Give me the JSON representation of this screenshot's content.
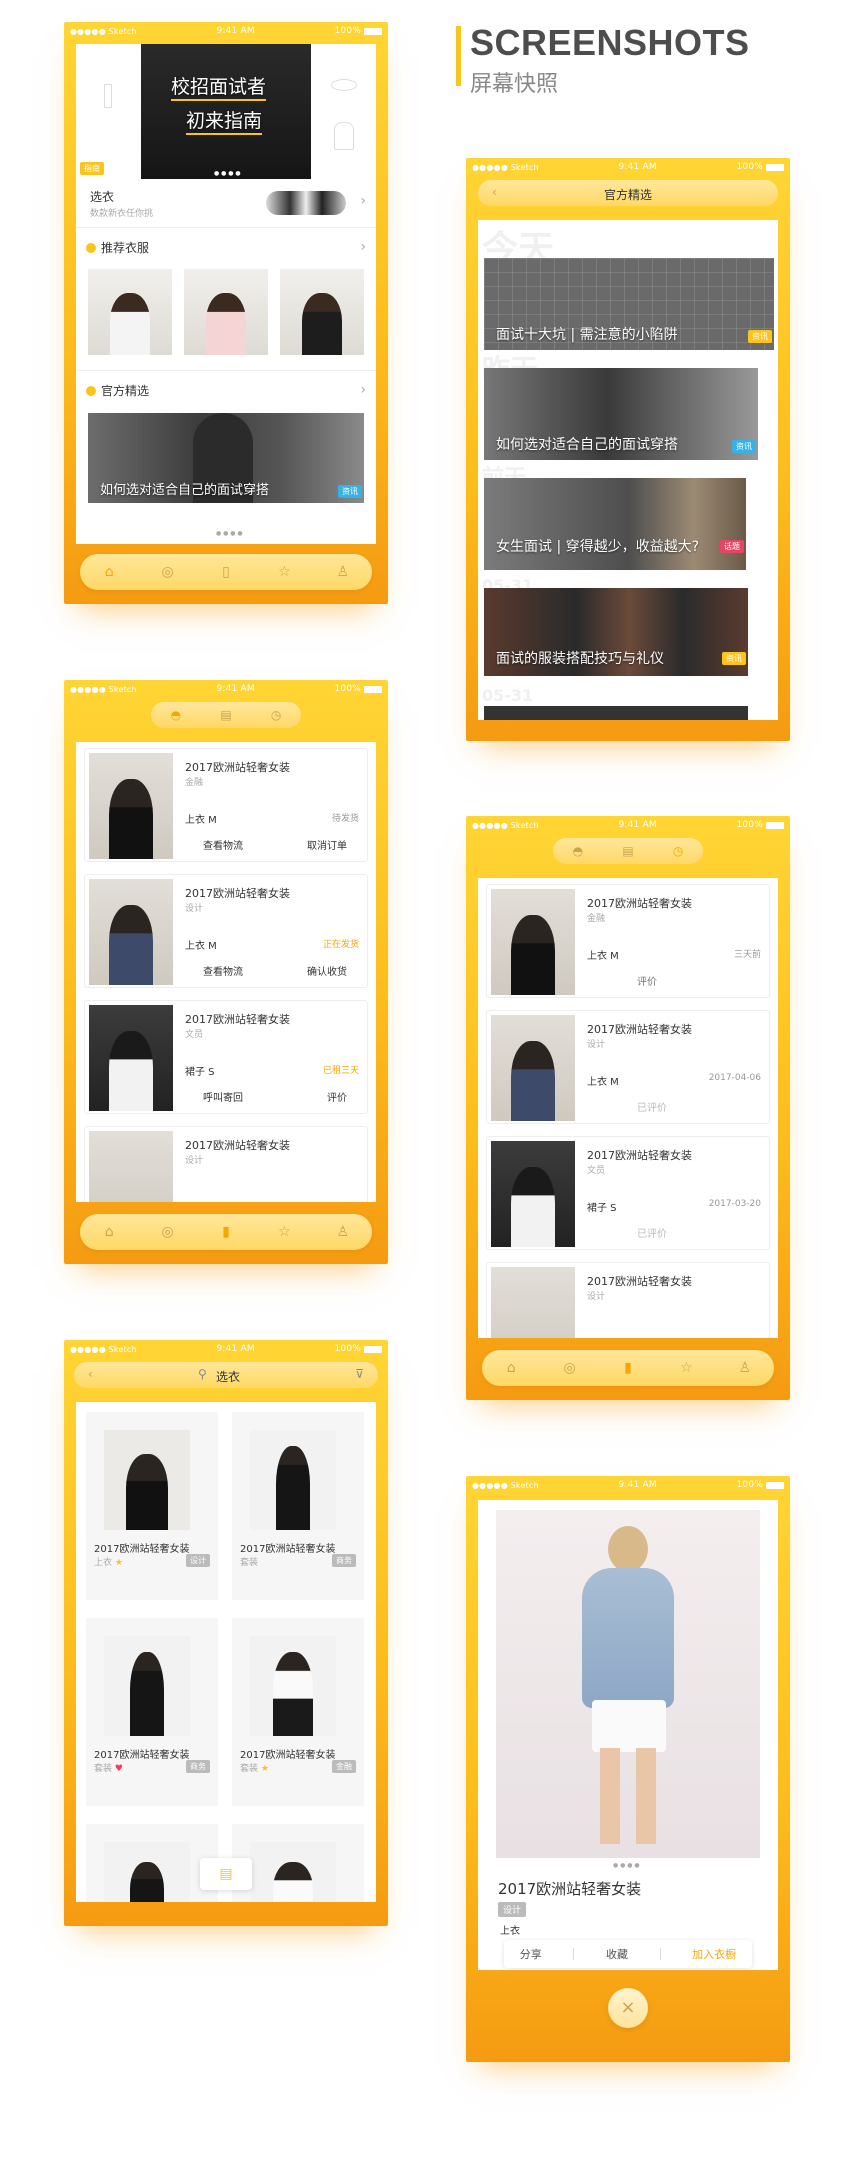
{
  "header": {
    "title_en": "SCREENSHOTS",
    "title_cn": "屏幕快照"
  },
  "status": {
    "carrier": "●●●●● Sketch",
    "time": "9:41 AM",
    "battery": "100%"
  },
  "home": {
    "banner_line1": "校招面试者",
    "banner_line2": "初来指南",
    "banner_tag": "指南",
    "pick_title": "选衣",
    "pick_sub": "数款新衣任你挑",
    "recommend_title": "推荐衣服",
    "official_title": "官方精选",
    "official_caption": "如何选对适合自己的面试穿搭",
    "official_tag": "资讯"
  },
  "official": {
    "nav_title": "官方精选",
    "ghost": [
      "今天",
      "昨天",
      "前天",
      "05-31",
      "05-31"
    ],
    "articles": [
      {
        "title": "面试十大坑 | 需注意的小陷阱",
        "tag": "资讯"
      },
      {
        "title": "如何选对适合自己的面试穿搭",
        "tag": "资讯"
      },
      {
        "title": "女生面试 | 穿得越少，收益越大?",
        "tag": "话题"
      },
      {
        "title": "面试的服装搭配技巧与礼仪",
        "tag": "资讯"
      }
    ]
  },
  "orders": [
    {
      "name": "2017欧洲站轻奢女装",
      "sub": "金融",
      "size": "上衣    M",
      "status": "待发货",
      "a1": "查看物流",
      "a2": "取消订单"
    },
    {
      "name": "2017欧洲站轻奢女装",
      "sub": "设计",
      "size": "上衣    M",
      "status": "正在发货",
      "a1": "查看物流",
      "a2": "确认收货"
    },
    {
      "name": "2017欧洲站轻奢女装",
      "sub": "文员",
      "size": "裙子    S",
      "status": "已租三天",
      "a1": "呼叫寄回",
      "a2": "评价"
    },
    {
      "name": "2017欧洲站轻奢女装",
      "sub": "设计"
    }
  ],
  "history": [
    {
      "name": "2017欧洲站轻奢女装",
      "sub": "金融",
      "size": "上衣    M",
      "date": "三天前",
      "action": "评价"
    },
    {
      "name": "2017欧洲站轻奢女装",
      "sub": "设计",
      "size": "上衣    M",
      "date": "2017-04-06",
      "action": "已评价"
    },
    {
      "name": "2017欧洲站轻奢女装",
      "sub": "文员",
      "size": "裙子    S",
      "date": "2017-03-20",
      "action": "已评价"
    },
    {
      "name": "2017欧洲站轻奢女装",
      "sub": "设计"
    }
  ],
  "catalog": {
    "search_label": "选衣",
    "items": [
      {
        "name": "2017欧洲站轻奢女装",
        "cat": "上衣",
        "tag": "设计"
      },
      {
        "name": "2017欧洲站轻奢女装",
        "cat": "套装",
        "tag": "商务"
      },
      {
        "name": "2017欧洲站轻奢女装",
        "cat": "套装",
        "tag": "商务"
      },
      {
        "name": "2017欧洲站轻奢女装",
        "cat": "套装",
        "tag": "金融"
      }
    ]
  },
  "detail": {
    "name": "2017欧洲站轻奢女装",
    "tag": "设计",
    "category": "上衣",
    "share": "分享",
    "collect": "收藏",
    "add": "加入衣橱",
    "close": "×"
  },
  "colors": {
    "accent": "#fbc41c",
    "accent_dark": "#f59b12",
    "text": "#333333"
  }
}
